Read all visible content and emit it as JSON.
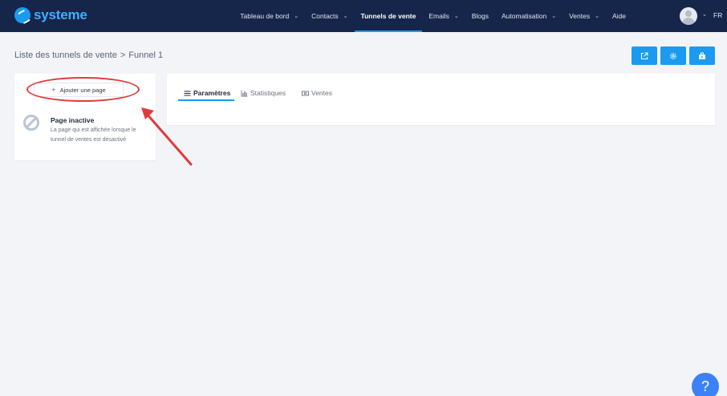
{
  "app": {
    "logo_text": "systeme"
  },
  "nav": {
    "items": [
      {
        "label": "Tableau de bord",
        "has_chevron": true,
        "active": false
      },
      {
        "label": "Contacts",
        "has_chevron": true,
        "active": false
      },
      {
        "label": "Tunnels de vente",
        "has_chevron": false,
        "active": true
      },
      {
        "label": "Emails",
        "has_chevron": true,
        "active": false
      },
      {
        "label": "Blogs",
        "has_chevron": false,
        "active": false
      },
      {
        "label": "Automatisation",
        "has_chevron": true,
        "active": false
      },
      {
        "label": "Ventes",
        "has_chevron": true,
        "active": false
      },
      {
        "label": "Aide",
        "has_chevron": false,
        "active": false
      }
    ],
    "chevron": "⌄",
    "language": "FR"
  },
  "breadcrumb": {
    "parent": "Liste des tunnels de vente",
    "separator": ">",
    "current": "Funnel 1"
  },
  "actions": [
    {
      "icon": "external-link-icon"
    },
    {
      "icon": "gear-icon"
    },
    {
      "icon": "briefcase-icon"
    }
  ],
  "left_panel": {
    "add_page_label": "Ajouter une page",
    "add_page_plus": "+",
    "inactive_title": "Page inactive",
    "inactive_description": "La page qui est affichée lorsque le tunnel de ventes est désactivé"
  },
  "tabs": [
    {
      "label": "Paramètres",
      "icon": "list-icon",
      "active": true
    },
    {
      "label": "Statistiques",
      "icon": "bar-chart-icon",
      "active": false
    },
    {
      "label": "Ventes",
      "icon": "money-icon",
      "active": false
    }
  ],
  "help": {
    "label": "?"
  },
  "colors": {
    "nav_bg": "#15264a",
    "accent": "#1a9bf0",
    "highlight": "#e4393c",
    "page_bg": "#f2f4f8"
  }
}
